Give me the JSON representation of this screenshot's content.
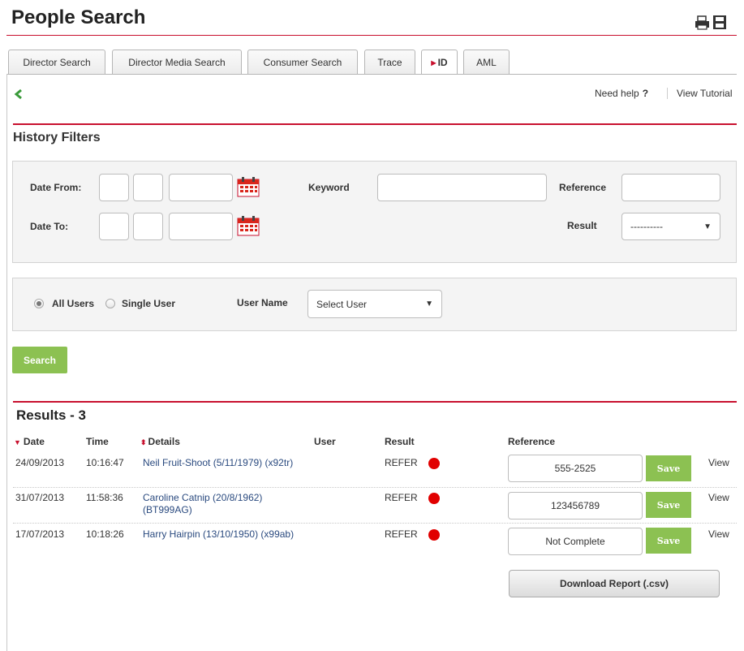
{
  "page": {
    "title": "People Search"
  },
  "tabs": [
    {
      "label": "Director Search",
      "active": false
    },
    {
      "label": "Director Media Search",
      "active": false
    },
    {
      "label": "Consumer Search",
      "active": false
    },
    {
      "label": "Trace",
      "active": false
    },
    {
      "label": "ID",
      "active": true
    },
    {
      "label": "AML",
      "active": false
    }
  ],
  "help": {
    "need_help": "Need help",
    "question_mark": "?",
    "view_tutorial": "View Tutorial"
  },
  "filters": {
    "heading": "History Filters",
    "date_from_label": "Date From:",
    "date_to_label": "Date To:",
    "keyword_label": "Keyword",
    "reference_label": "Reference",
    "result_label": "Result",
    "result_selected": "----------",
    "all_users_label": "All Users",
    "single_user_label": "Single User",
    "selected_scope": "All Users",
    "user_name_label": "User Name",
    "user_select_value": "Select User",
    "search_button": "Search"
  },
  "results": {
    "heading": "Results - 3",
    "columns": {
      "date": "Date",
      "time": "Time",
      "details": "Details",
      "user": "User",
      "result": "Result",
      "reference": "Reference"
    },
    "rows": [
      {
        "date": "24/09/2013",
        "time": "10:16:47",
        "details_line1": "Neil Fruit-Shoot (5/11/1979) (x92tr)",
        "details_line2": "",
        "user": "",
        "result": "REFER",
        "reference": "555-2525",
        "save": "Save",
        "view": "View"
      },
      {
        "date": "31/07/2013",
        "time": "11:58:36",
        "details_line1": "Caroline Catnip (20/8/1962)",
        "details_line2": "(BT999AG)",
        "user": "",
        "result": "REFER",
        "reference": "123456789",
        "save": "Save",
        "view": "View"
      },
      {
        "date": "17/07/2013",
        "time": "10:18:26",
        "details_line1": "Harry Hairpin (13/10/1950) (x99ab)",
        "details_line2": "",
        "user": "",
        "result": "REFER",
        "reference": "Not Complete",
        "save": "Save",
        "view": "View"
      }
    ],
    "download_button": "Download Report (.csv)"
  },
  "colors": {
    "brand_red": "#c8102e",
    "button_green": "#8cc152",
    "result_refer": "#e10000",
    "link_blue": "#2a4a7f"
  },
  "icons": {
    "print": "printer-icon",
    "save_page": "floppy-icon",
    "back": "chevron-left-icon",
    "calendar": "calendar-icon"
  }
}
